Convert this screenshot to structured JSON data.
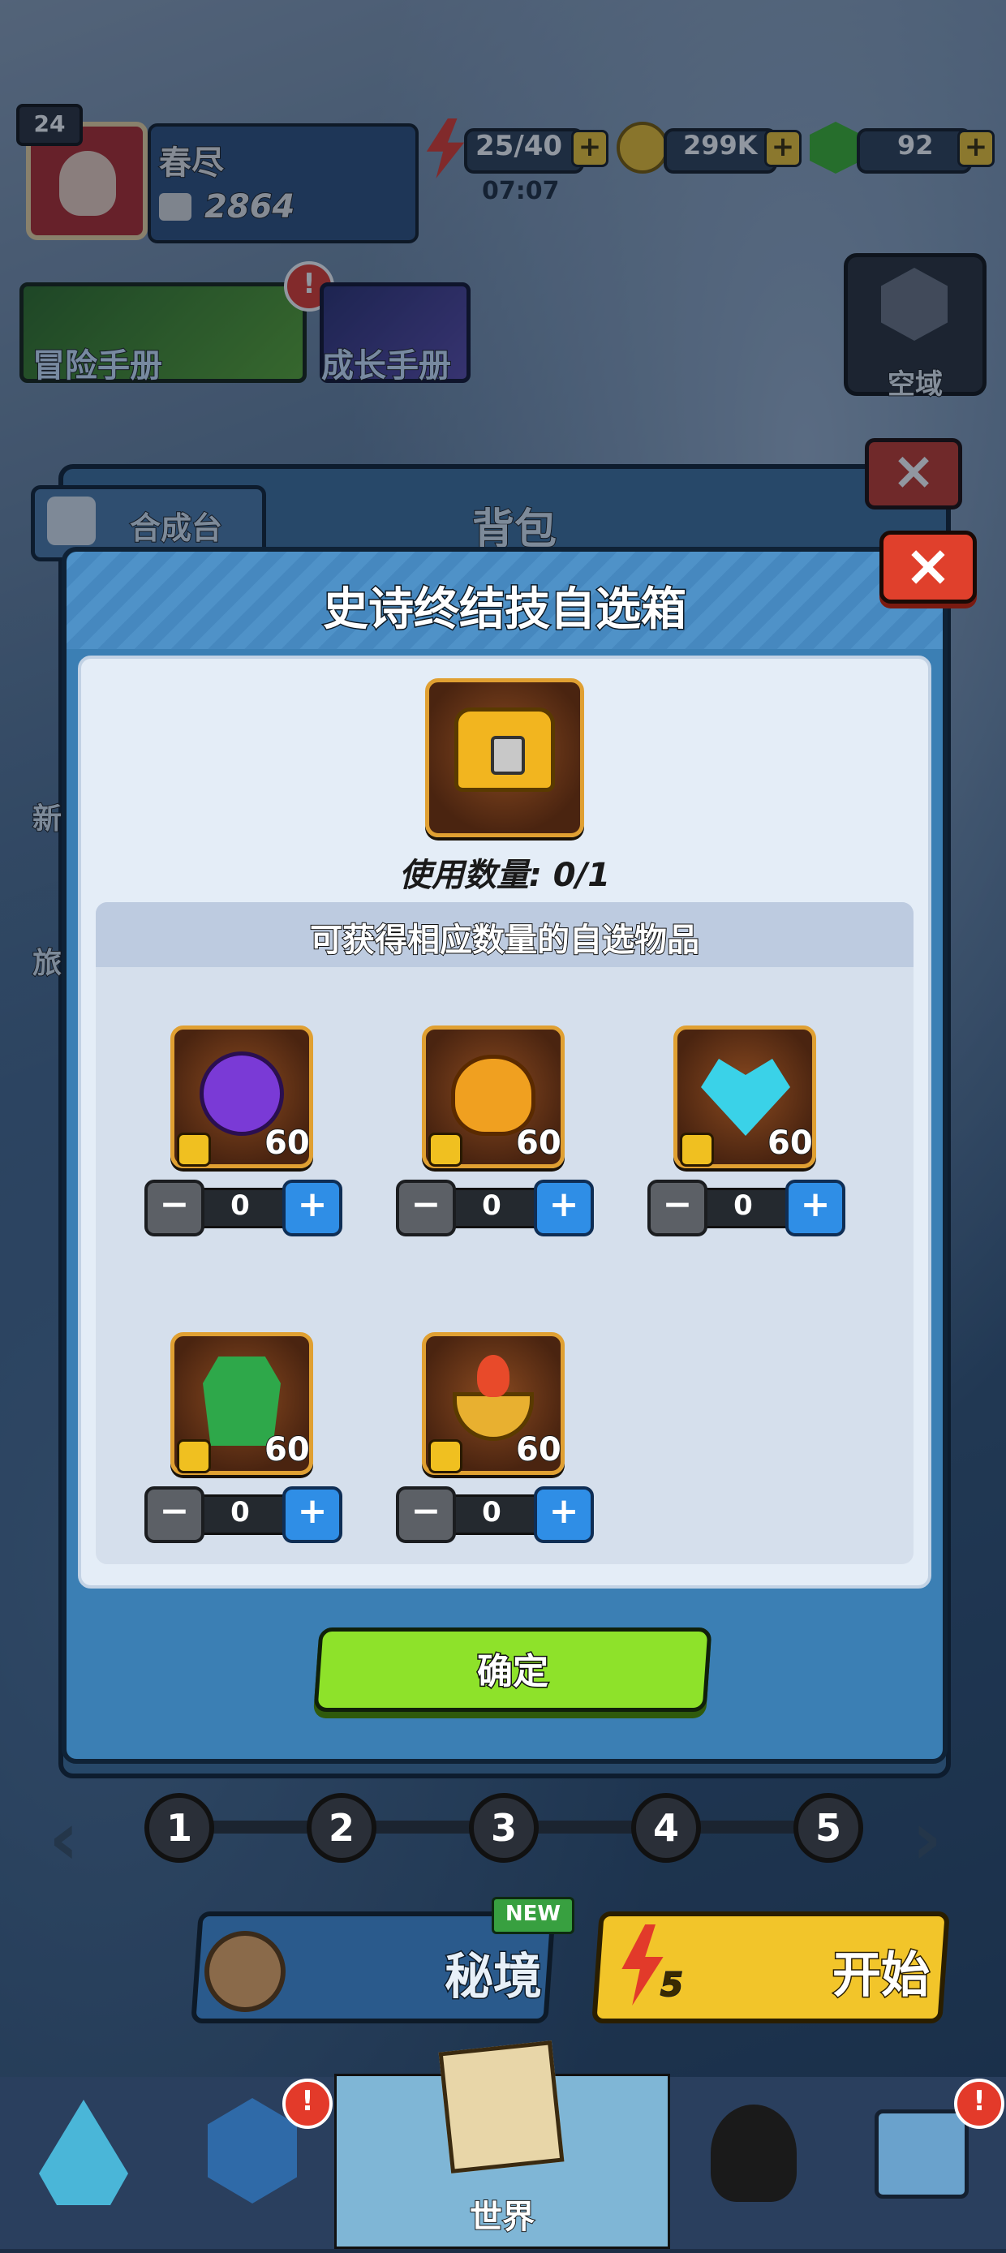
{
  "player": {
    "level": "24",
    "name": "春尽",
    "power": "2864"
  },
  "resources": {
    "energy": "25/40",
    "energy_timer": "07:07",
    "coins": "299K",
    "gems": "92"
  },
  "menu": {
    "adventure_manual": "冒险手册",
    "growth_manual": "成长手册",
    "airspace": "空域",
    "alert_mark": "!"
  },
  "background_panel": {
    "crafting_tab": "合成台",
    "title": "背包",
    "side_labels": [
      "新",
      "旅"
    ]
  },
  "dialog": {
    "title": "史诗终结技自选箱",
    "usage_label": "使用数量: 0/1",
    "section_header": "可获得相应数量的自选物品",
    "items": [
      {
        "icon": "purple-magic-disc-icon",
        "count": "60",
        "value": "0"
      },
      {
        "icon": "flame-owl-pot-icon",
        "count": "60",
        "value": "0"
      },
      {
        "icon": "ice-crystal-heart-icon",
        "count": "60",
        "value": "0"
      },
      {
        "icon": "green-cloak-icon",
        "count": "60",
        "value": "0"
      },
      {
        "icon": "fire-bowl-icon",
        "count": "60",
        "value": "0"
      }
    ],
    "minus_symbol": "−",
    "plus_symbol": "+",
    "confirm_label": "确定",
    "close_symbol": "×"
  },
  "stages": {
    "nodes": [
      "1",
      "2",
      "3",
      "4",
      "5"
    ],
    "prev_symbol": "‹",
    "next_symbol": "›"
  },
  "actions": {
    "secret_realm": "秘境",
    "new_badge": "NEW",
    "start": "开始",
    "start_cost": "5"
  },
  "bottom_nav": {
    "world": "世界"
  },
  "colors": {
    "dialog_blue": "#3b7fb4",
    "confirm_green": "#8ee22a",
    "close_red": "#e0402c",
    "slot_border": "#e0a032"
  }
}
